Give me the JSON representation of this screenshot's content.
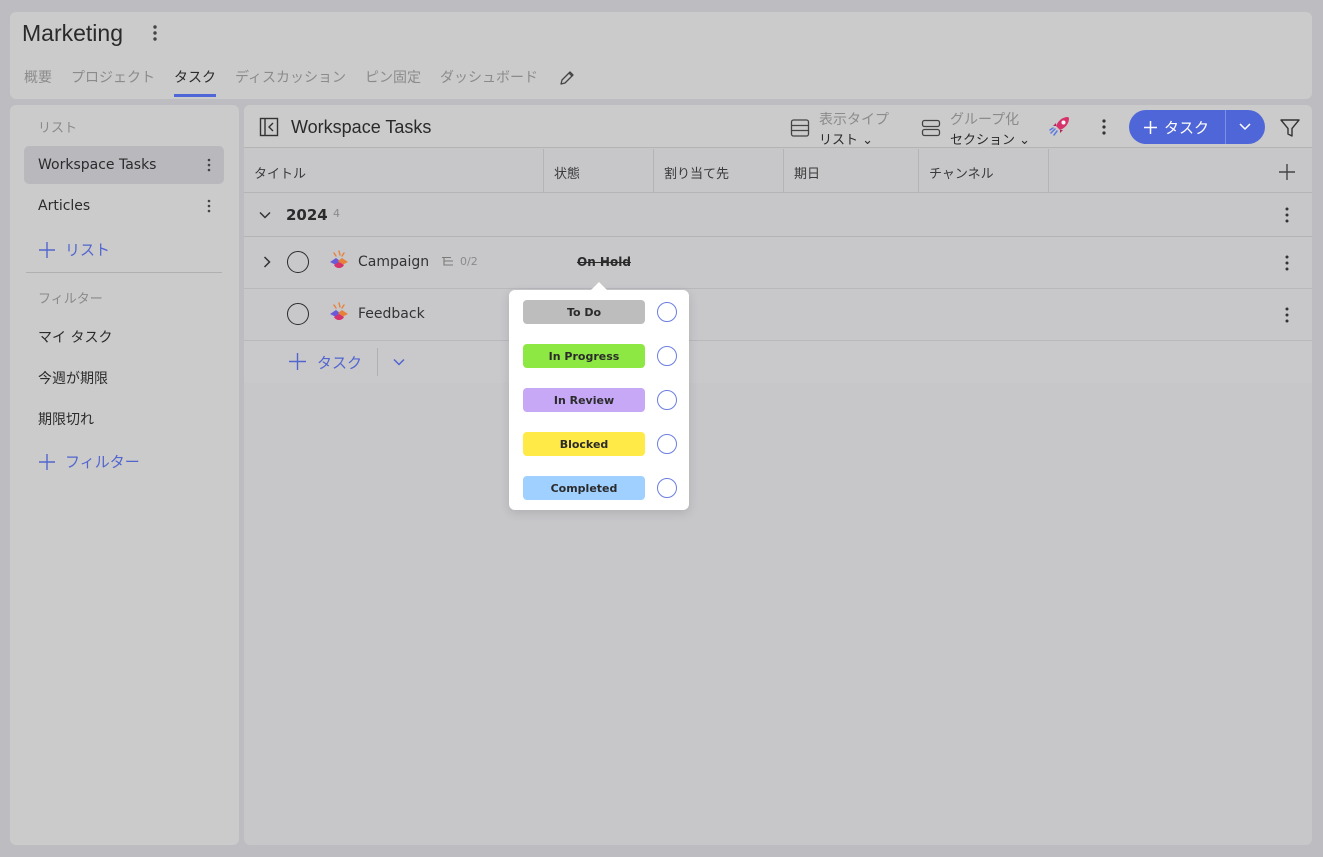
{
  "workspace": {
    "title": "Marketing"
  },
  "tabs": [
    {
      "label": "概要",
      "active": false
    },
    {
      "label": "プロジェクト",
      "active": false
    },
    {
      "label": "タスク",
      "active": true
    },
    {
      "label": "ディスカッション",
      "active": false
    },
    {
      "label": "ピン固定",
      "active": false
    },
    {
      "label": "ダッシュボード",
      "active": false
    }
  ],
  "sidebar": {
    "lists_label": "リスト",
    "lists": [
      {
        "label": "Workspace Tasks",
        "active": true
      },
      {
        "label": "Articles",
        "active": false
      }
    ],
    "add_list_label": "リスト",
    "filters_label": "フィルター",
    "filters": [
      {
        "label": "マイ タスク"
      },
      {
        "label": "今週が期限"
      },
      {
        "label": "期限切れ"
      }
    ],
    "add_filter_label": "フィルター"
  },
  "main": {
    "title": "Workspace Tasks",
    "view_type": {
      "label": "表示タイプ",
      "value": "リスト"
    },
    "group_by": {
      "label": "グループ化",
      "value": "セクション"
    },
    "add_task_label": "タスク",
    "columns": [
      "タイトル",
      "状態",
      "割り当て先",
      "期日",
      "チャンネル"
    ],
    "group": {
      "name": "2024",
      "count": "4"
    },
    "tasks": [
      {
        "name": "Campaign",
        "subtasks": "0/2",
        "status": "On Hold"
      },
      {
        "name": "Feedback",
        "subtasks": "",
        "status": ""
      }
    ],
    "add_row_label": "タスク"
  },
  "status_menu": {
    "options": [
      {
        "label": "To Do",
        "color": "#bdbdbd"
      },
      {
        "label": "In Progress",
        "color": "#8de844"
      },
      {
        "label": "In Review",
        "color": "#c6a8f7"
      },
      {
        "label": "Blocked",
        "color": "#ffea47"
      },
      {
        "label": "Completed",
        "color": "#9fd0ff"
      }
    ]
  },
  "colors": {
    "accent": "#4f66d9"
  }
}
